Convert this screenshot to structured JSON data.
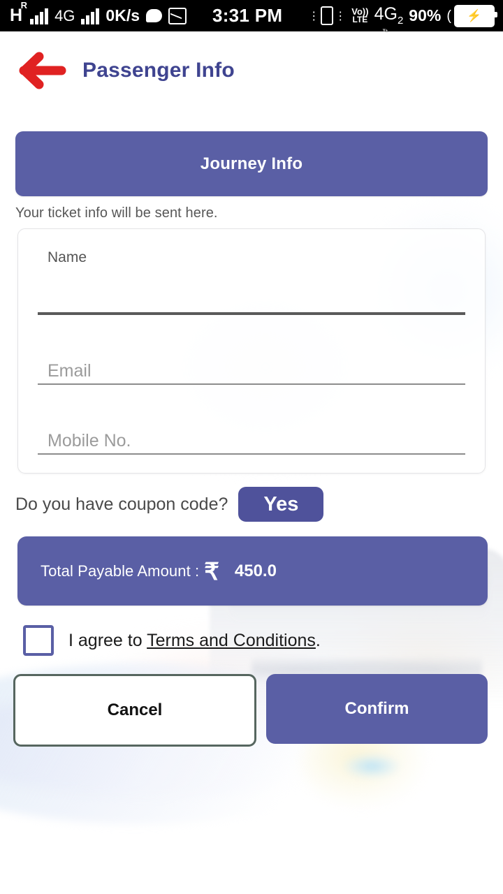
{
  "status_bar": {
    "network_type": "H",
    "roaming_indicator": "R",
    "network_4g": "4G",
    "data_speed": "0K/s",
    "chat_icon": "chat-bubble-icon",
    "mail_icon": "envelope-icon",
    "time": "3:31 PM",
    "vibrate_icon": "vibrate-icon",
    "volte_top": "Vo))",
    "volte_bottom": "LTE",
    "sim_network": "4G",
    "sim_index": "2",
    "battery_percent": "90%",
    "battery_charging_icon": "charging-bolt-icon"
  },
  "header": {
    "back_icon": "arrow-left-icon",
    "title": "Passenger Info",
    "title_color": "#3f4490",
    "back_icon_color": "#e02222"
  },
  "main": {
    "journey_info_label": "Journey Info",
    "ticket_note": "Your ticket info will be sent here.",
    "form": {
      "name": {
        "label": "Name",
        "value": ""
      },
      "email": {
        "placeholder": "Email",
        "value": ""
      },
      "mobile": {
        "placeholder": "Mobile No.",
        "value": ""
      }
    },
    "coupon": {
      "question": "Do you have coupon code?",
      "yes_label": "Yes"
    },
    "total": {
      "label": "Total Payable Amount :",
      "currency_symbol": "₹",
      "amount": "450.0"
    },
    "terms": {
      "checked": false,
      "prefix": "I agree to ",
      "link_label": "Terms and Conditions",
      "suffix": "."
    },
    "actions": {
      "cancel_label": "Cancel",
      "confirm_label": "Confirm"
    }
  },
  "theme": {
    "primary_purple": "#5a5fa5",
    "accent_purple": "#4f529b",
    "title_indigo": "#3f4490",
    "back_red": "#e02222",
    "cancel_border": "#56665f",
    "page_background": "#ffffff"
  }
}
